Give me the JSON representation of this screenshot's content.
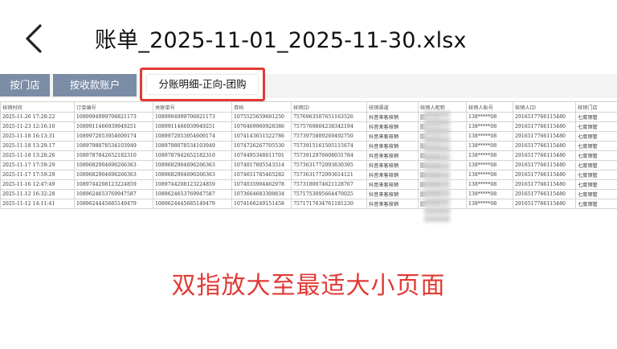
{
  "header": {
    "title": "账单_2025-11-01_2025-11-30.xlsx",
    "back_icon": "chevron-left-icon"
  },
  "tabs": [
    {
      "label": "按门店"
    },
    {
      "label": "按收款账户"
    },
    {
      "label": "分账明细-正向-团购",
      "active": true
    }
  ],
  "colors": {
    "accent_red": "#e23a35",
    "tab_bg": "#7b8ca6"
  },
  "sheet": {
    "headers": [
      "核销时间",
      "订单编号",
      "关联单号",
      "券码",
      "核销ID",
      "核销渠道",
      "核销人昵称",
      "核销人账号",
      "核销人ID",
      "核销门店"
    ],
    "rows": [
      [
        "2025-11-26 17:28:22",
        "1089994999706821173",
        "1089994999706821173",
        "1075525659691250",
        "7576963507651163526",
        "抖音来客核销",
        "",
        "138*****08",
        "2916517766115480",
        "七度钢管"
      ],
      [
        "2025-11-23 12:16:10",
        "1089911466939949251",
        "1089911466939949251",
        "1070469960928386",
        "7575769804238342194",
        "抖音来客核销",
        "",
        "138*****08",
        "2916517766115480",
        "七度钢管"
      ],
      [
        "2025-11-18 16:13:31",
        "1089972053954609174",
        "1089972053954609174",
        "1074143651522786",
        "7573975809269492750",
        "抖音来客核销",
        "",
        "138*****08",
        "2916517766115480",
        "七度钢管"
      ],
      [
        "2025-11-18 13:29:17",
        "1089798078534103949",
        "1089798078534103949",
        "1074726267705530",
        "7573915161505115674",
        "抖音来客核销",
        "",
        "138*****08",
        "2916517766115480",
        "七度钢管"
      ],
      [
        "2025-11-18 13:28:26",
        "1089787842652182310",
        "1089787842652182310",
        "1074495348011701",
        "7573912970608031784",
        "抖音来客核销",
        "",
        "138*****08",
        "2916517766115480",
        "七度钢管"
      ],
      [
        "2025-11-17 17:59:29",
        "1089682904696266363",
        "1089682904696266363",
        "1074017805543314",
        "7573631772093630395",
        "抖音来客核销",
        "",
        "138*****08",
        "2916517766115480",
        "七度钢管"
      ],
      [
        "2025-11-17 17:59:29",
        "1089682904696266363",
        "1089682904696266363",
        "1074651785465282",
        "7573631772093614121",
        "抖音来客核销",
        "",
        "138*****08",
        "2916517766115480",
        "七度钢管"
      ],
      [
        "2025-11-16 12:47:49",
        "1089744208123224859",
        "1089744208123224859",
        "1074035904462978",
        "7573180074621128767",
        "抖音来客核销",
        "",
        "138*****08",
        "2916517766115480",
        "七度钢管"
      ],
      [
        "2025-11-12 16:32:28",
        "1089624653769947587",
        "1089624653769947587",
        "1073664683308834",
        "7571753095664470025",
        "抖音来客核销",
        "",
        "138*****08",
        "2916517766115480",
        "七度钢管"
      ],
      [
        "2025-11-12 14:11:41",
        "1089624445685149479",
        "1089624445685149479",
        "1074166249151458",
        "7571717634761181230",
        "抖音来客核销",
        "",
        "138*****08",
        "2916517766115480",
        "七度钢管"
      ]
    ]
  },
  "caption": "双指放大至最适大小页面"
}
